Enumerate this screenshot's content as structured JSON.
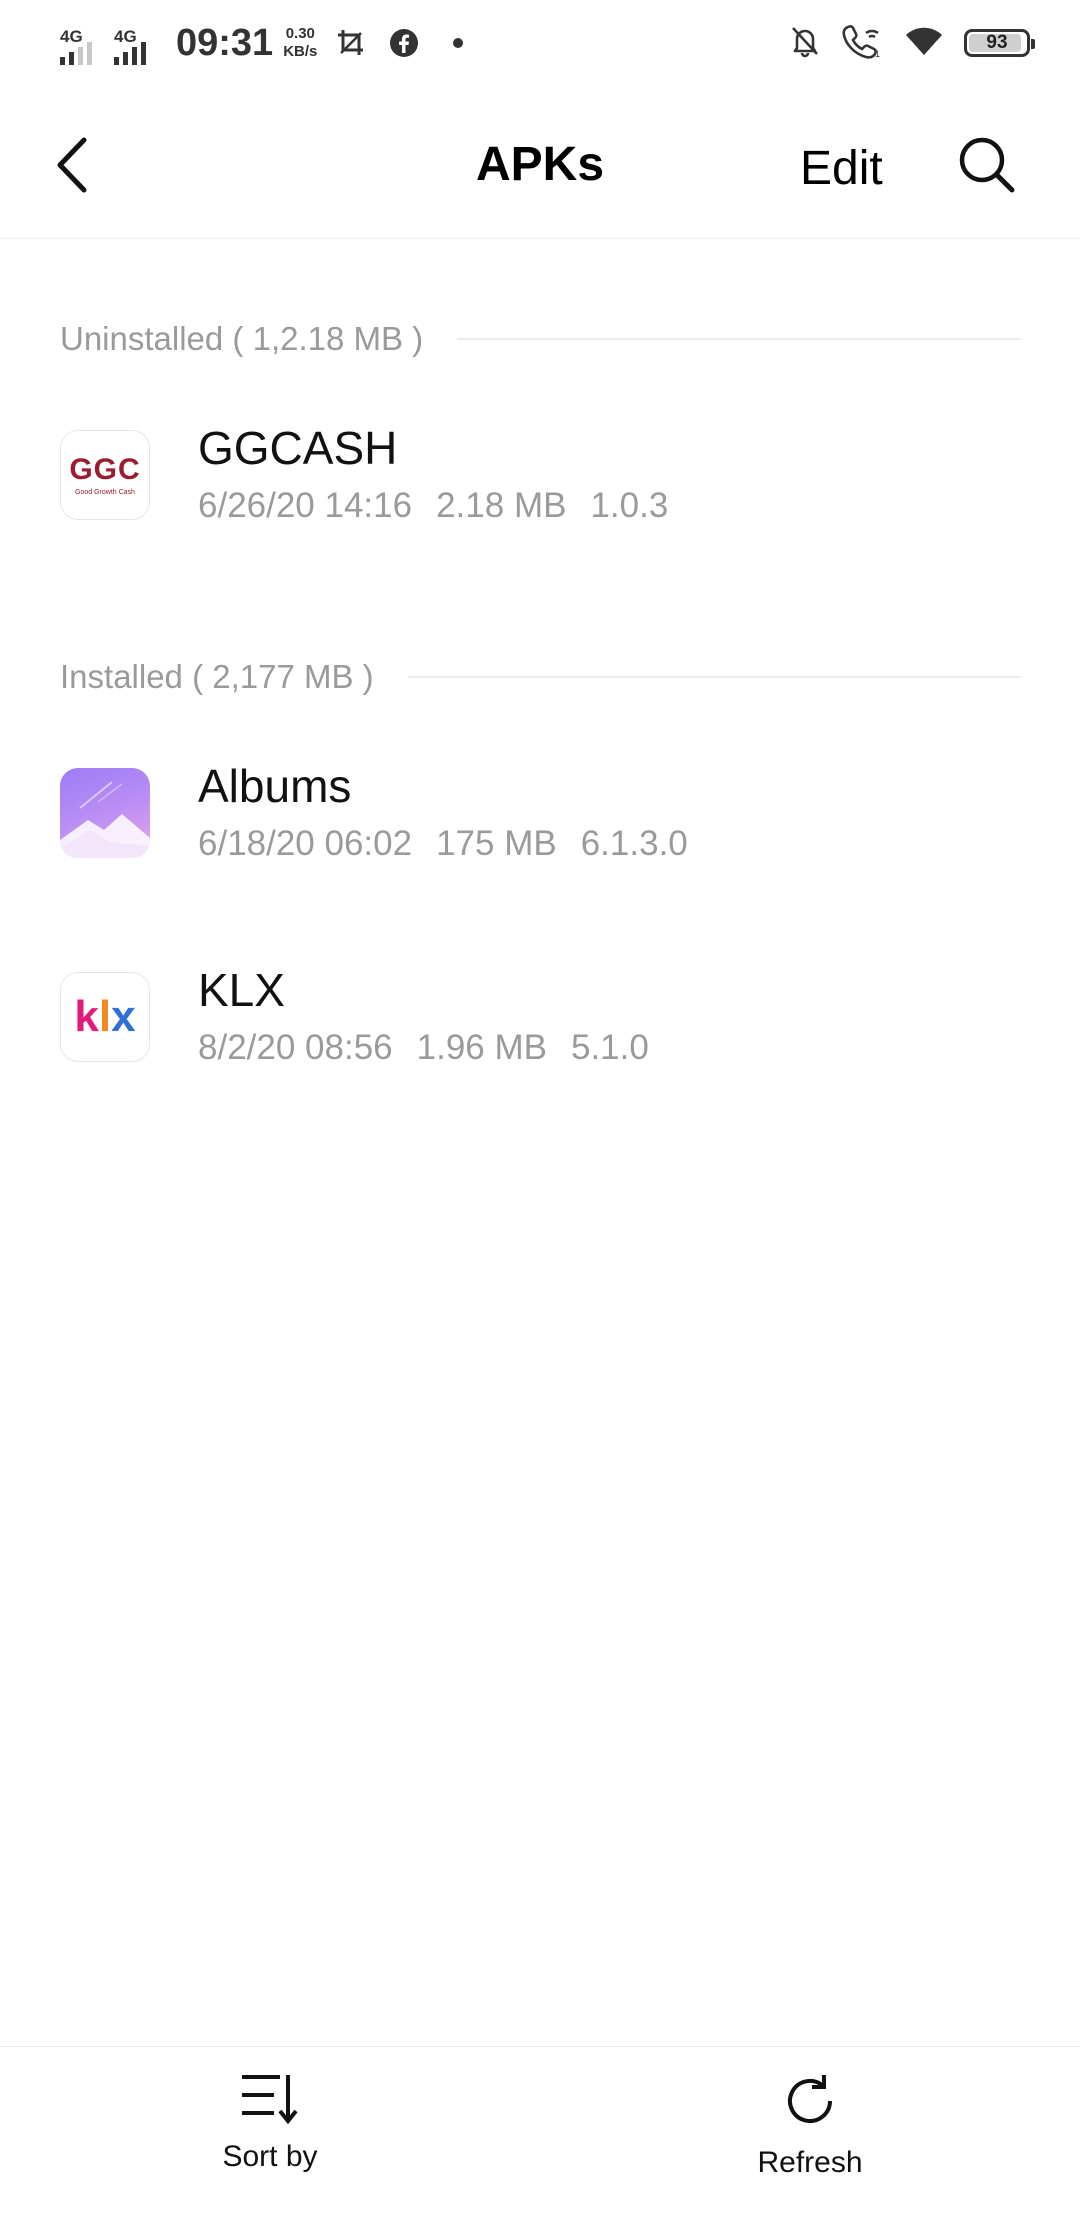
{
  "status_bar": {
    "network_1": "4G",
    "network_2": "4G",
    "time": "09:31",
    "speed_value": "0.30",
    "speed_unit": "KB/s",
    "battery": "93",
    "icons": [
      "screenshot-icon",
      "facebook-icon",
      "notification-dot-icon",
      "bell-off-icon",
      "wifi-calling-icon",
      "wifi-icon",
      "battery-icon"
    ]
  },
  "header": {
    "title": "APKs",
    "edit_label": "Edit",
    "back_icon": "back-icon",
    "search_icon": "search-icon"
  },
  "sections": [
    {
      "label": "Uninstalled ( 1,2.18 MB )",
      "items": [
        {
          "name": "GGCASH",
          "date": "6/26/20 14:16",
          "size": "2.18 MB",
          "version": "1.0.3",
          "icon": "ggcash-app-icon",
          "icon_text": "GGC",
          "icon_subtext": "Good Growth Cash"
        }
      ]
    },
    {
      "label": "Installed ( 2,177 MB )",
      "items": [
        {
          "name": "Albums",
          "date": "6/18/20 06:02",
          "size": "175 MB",
          "version": "6.1.3.0",
          "icon": "albums-app-icon"
        },
        {
          "name": "KLX",
          "date": "8/2/20 08:56",
          "size": "1.96 MB",
          "version": "5.1.0",
          "icon": "klx-app-icon"
        }
      ]
    }
  ],
  "bottom_bar": {
    "sort_label": "Sort by",
    "refresh_label": "Refresh"
  },
  "colors": {
    "primary_text": "#111111",
    "secondary_text": "#9a9a9a",
    "divider": "#ececec",
    "ggc_brand": "#9b1c2e",
    "klx_pink": "#e5197a",
    "klx_blue": "#2f6fd6"
  }
}
